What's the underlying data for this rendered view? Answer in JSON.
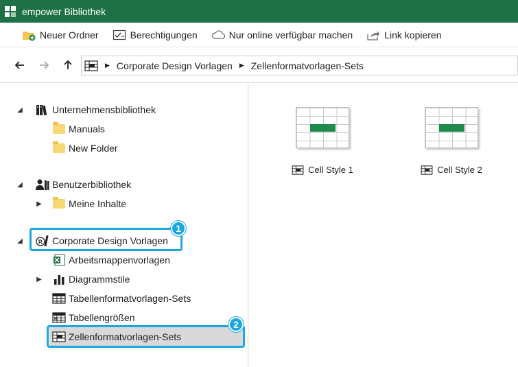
{
  "window": {
    "title": "empower Bibliothek"
  },
  "toolbar": {
    "new_folder": "Neuer Ordner",
    "permissions": "Berechtigungen",
    "online_only": "Nur online verfügbar machen",
    "copy_link": "Link kopieren"
  },
  "breadcrumb": [
    "Corporate Design Vorlagen",
    "Zellenformatvorlagen-Sets"
  ],
  "tree": {
    "company_library": "Unternehmensbibliothek",
    "manuals": "Manuals",
    "new_folder": "New Folder",
    "user_library": "Benutzerbibliothek",
    "my_content": "Meine Inhalte",
    "corporate_design": "Corporate Design Vorlagen",
    "workbook_templates": "Arbeitsmappenvorlagen",
    "chart_styles": "Diagrammstile",
    "table_format_sets": "Tabellenformatvorlagen-Sets",
    "table_sizes": "Tabellengrößen",
    "cell_format_sets": "Zellenformatvorlagen-Sets"
  },
  "callouts": {
    "first": "1",
    "second": "2"
  },
  "items": [
    {
      "name": "Cell Style 1"
    },
    {
      "name": "Cell Style 2"
    }
  ],
  "colors": {
    "titlebar": "#1e7145",
    "accent": "#1aa7e0",
    "selection": "#d9d9d9",
    "cell_fill": "#1e8a4c"
  }
}
